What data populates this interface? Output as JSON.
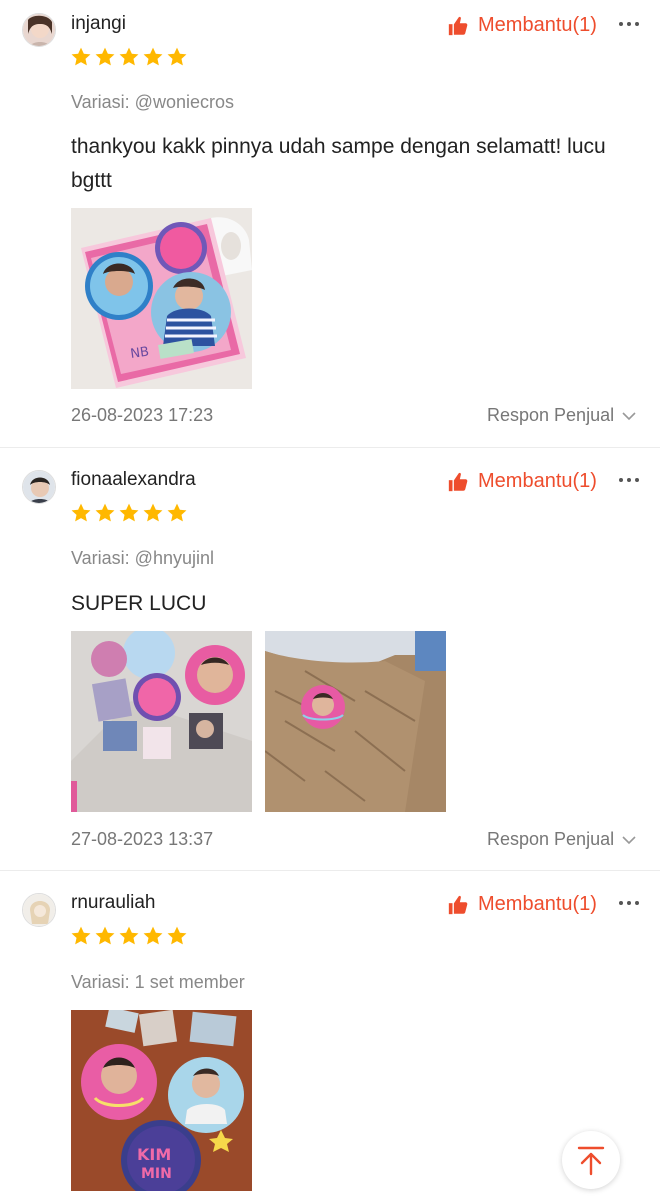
{
  "accent_color": "#ee4d2d",
  "star_color": "#ffb800",
  "reviews": [
    {
      "username": "injangi",
      "helpful_label": "Membantu(1)",
      "rating": 5,
      "variation": "Variasi: @woniecros",
      "comment": "thankyou kakk pinnya udah sampe dengan selamatt! lucu bgttt",
      "photo_count": 1,
      "date": "26-08-2023 17:23",
      "seller_response_label": "Respon Penjual"
    },
    {
      "username": "fionaalexandra",
      "helpful_label": "Membantu(1)",
      "rating": 5,
      "variation": "Variasi: @hnyujinl",
      "comment": "SUPER LUCU",
      "photo_count": 2,
      "date": "27-08-2023 13:37",
      "seller_response_label": "Respon Penjual"
    },
    {
      "username": "rnurauliah",
      "helpful_label": "Membantu(1)",
      "rating": 5,
      "variation": "Variasi: 1 set member",
      "comment": "",
      "photo_count": 1
    }
  ],
  "icons": {
    "helpful": "thumbs-up-icon",
    "more": "more-dots-icon",
    "chevron": "chevron-down-icon",
    "scroll_top": "scroll-to-top-icon"
  }
}
